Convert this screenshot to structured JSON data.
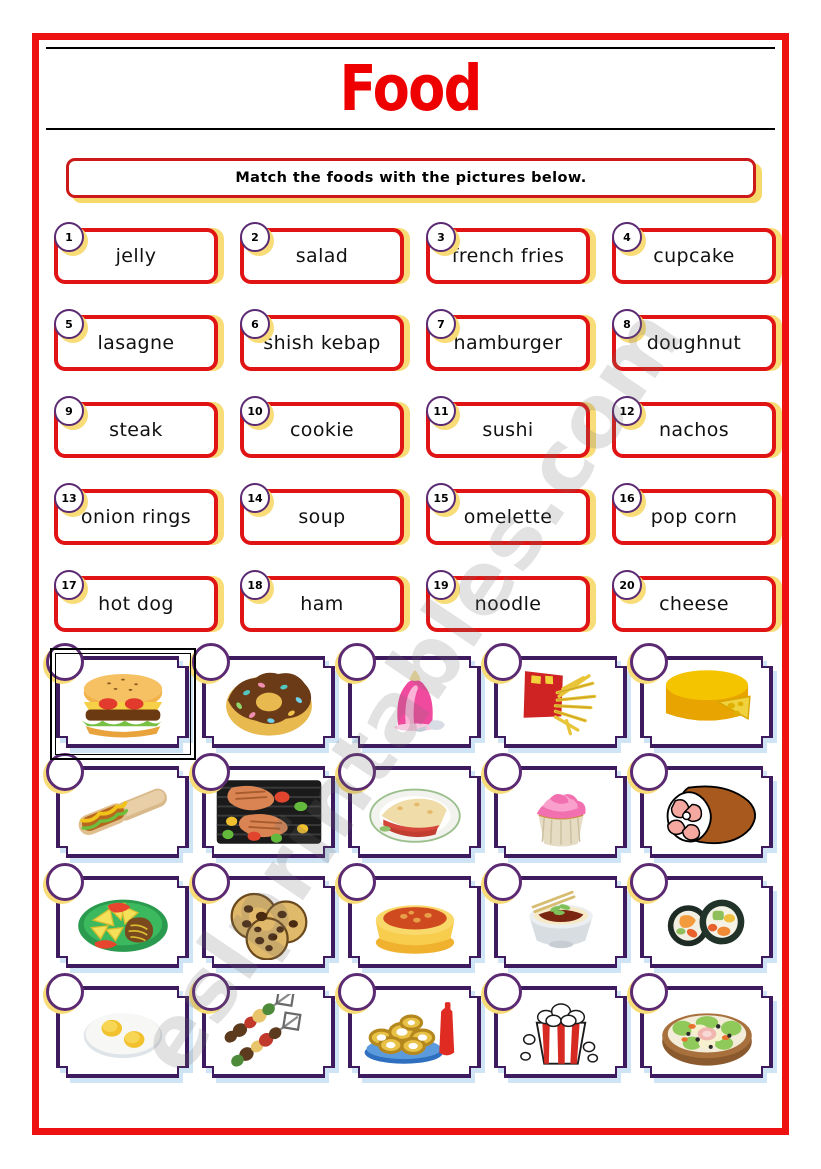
{
  "worksheet": {
    "title": "Food",
    "instruction": "Match the foods with the pictures below.",
    "watermark": "eslprintables.com"
  },
  "colors": {
    "frame_red": "#ee1111",
    "box_red": "#e01414",
    "shadow_yellow": "#f8dc77",
    "circle_purple": "#5b2a72",
    "picture_frame_purple": "#3d1b5e",
    "title_red": "#ee0000"
  },
  "word_bank": {
    "rows": [
      [
        {
          "number": "1",
          "label": "jelly"
        },
        {
          "number": "2",
          "label": "salad"
        },
        {
          "number": "3",
          "label": "french fries"
        },
        {
          "number": "4",
          "label": "cupcake"
        }
      ],
      [
        {
          "number": "5",
          "label": "lasagne"
        },
        {
          "number": "6",
          "label": "shish kebap"
        },
        {
          "number": "7",
          "label": "hamburger"
        },
        {
          "number": "8",
          "label": "doughnut"
        }
      ],
      [
        {
          "number": "9",
          "label": "steak"
        },
        {
          "number": "10",
          "label": "cookie"
        },
        {
          "number": "11",
          "label": "sushi"
        },
        {
          "number": "12",
          "label": "nachos"
        }
      ],
      [
        {
          "number": "13",
          "label": "onion rings"
        },
        {
          "number": "14",
          "label": "soup"
        },
        {
          "number": "15",
          "label": "omelette"
        },
        {
          "number": "16",
          "label": "pop corn"
        }
      ],
      [
        {
          "number": "17",
          "label": "hot dog"
        },
        {
          "number": "18",
          "label": "ham"
        },
        {
          "number": "19",
          "label": "noodle"
        },
        {
          "number": "20",
          "label": "cheese"
        }
      ]
    ]
  },
  "picture_bank": {
    "answer_value": "",
    "rows": [
      [
        {
          "icon": "hamburger-icon",
          "selected": true
        },
        {
          "icon": "doughnut-icon",
          "selected": false
        },
        {
          "icon": "jelly-icon",
          "selected": false
        },
        {
          "icon": "french-fries-icon",
          "selected": false
        },
        {
          "icon": "cheese-icon",
          "selected": false
        }
      ],
      [
        {
          "icon": "hot-dog-icon",
          "selected": false
        },
        {
          "icon": "steak-icon",
          "selected": false
        },
        {
          "icon": "lasagne-icon",
          "selected": false
        },
        {
          "icon": "cupcake-icon",
          "selected": false
        },
        {
          "icon": "ham-icon",
          "selected": false
        }
      ],
      [
        {
          "icon": "nachos-icon",
          "selected": false
        },
        {
          "icon": "cookie-icon",
          "selected": false
        },
        {
          "icon": "soup-icon",
          "selected": false
        },
        {
          "icon": "noodle-icon",
          "selected": false
        },
        {
          "icon": "sushi-icon",
          "selected": false
        }
      ],
      [
        {
          "icon": "omelette-icon",
          "selected": false
        },
        {
          "icon": "shish-kebap-icon",
          "selected": false
        },
        {
          "icon": "onion-rings-icon",
          "selected": false
        },
        {
          "icon": "pop-corn-icon",
          "selected": false
        },
        {
          "icon": "salad-icon",
          "selected": false
        }
      ]
    ]
  }
}
